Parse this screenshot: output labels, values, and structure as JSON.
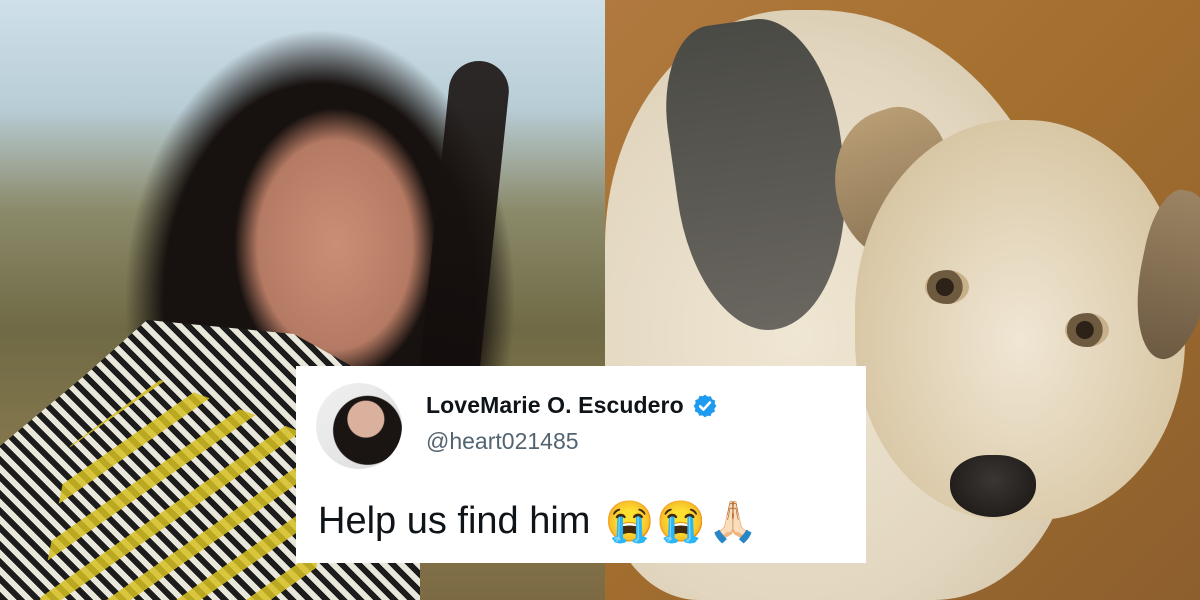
{
  "tweet": {
    "display_name": "LoveMarie O. Escudero",
    "handle": "@heart021485",
    "text": "Help us find him",
    "emojis": [
      "😭",
      "😭",
      "🙏🏻"
    ],
    "verified_color": "#1d9bf0"
  },
  "icons": {
    "verified": "verified-badge-icon",
    "avatar": "profile-avatar"
  }
}
